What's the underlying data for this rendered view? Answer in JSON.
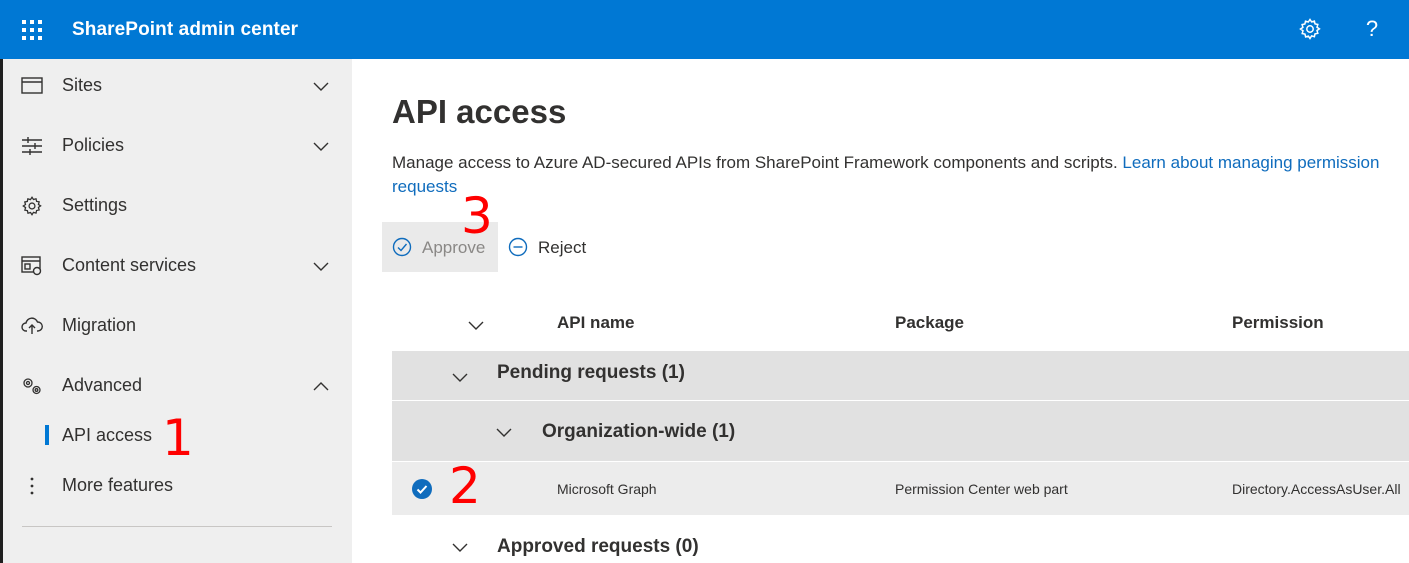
{
  "header": {
    "app_title": "SharePoint admin center",
    "waffle_icon": "app-launcher-icon",
    "settings_icon": "gear-icon",
    "help_label": "?"
  },
  "sidebar": {
    "items": [
      {
        "label": "Sites",
        "icon": "window-icon",
        "expand": "chevron-down"
      },
      {
        "label": "Policies",
        "icon": "sliders-icon",
        "expand": "chevron-down"
      },
      {
        "label": "Settings",
        "icon": "gear-icon"
      },
      {
        "label": "Content services",
        "icon": "content-icon",
        "expand": "chevron-down"
      },
      {
        "label": "Migration",
        "icon": "cloud-upload-icon"
      },
      {
        "label": "Advanced",
        "icon": "gears-icon",
        "expand": "chevron-up"
      }
    ],
    "sub_item": "API access",
    "more_label": "More features"
  },
  "main": {
    "title": "API access",
    "description": "Manage access to Azure AD-secured APIs from SharePoint Framework components and scripts.",
    "learn_link": "Learn about managing permission requests",
    "approve_label": "Approve",
    "reject_label": "Reject",
    "columns": [
      "API name",
      "Package",
      "Permission"
    ],
    "pending_group": "Pending requests (1)",
    "org_group": "Organization-wide (1)",
    "row": {
      "api": "Microsoft Graph",
      "package": "Permission Center web part",
      "permission": "Directory.AccessAsUser.All"
    },
    "approved_group": "Approved requests (0)"
  },
  "annotations": {
    "one": "1",
    "two": "2",
    "three": "3"
  },
  "colors": {
    "brand": "#0078d4",
    "link": "#0f6cbd",
    "annotation": "#ff0000"
  }
}
